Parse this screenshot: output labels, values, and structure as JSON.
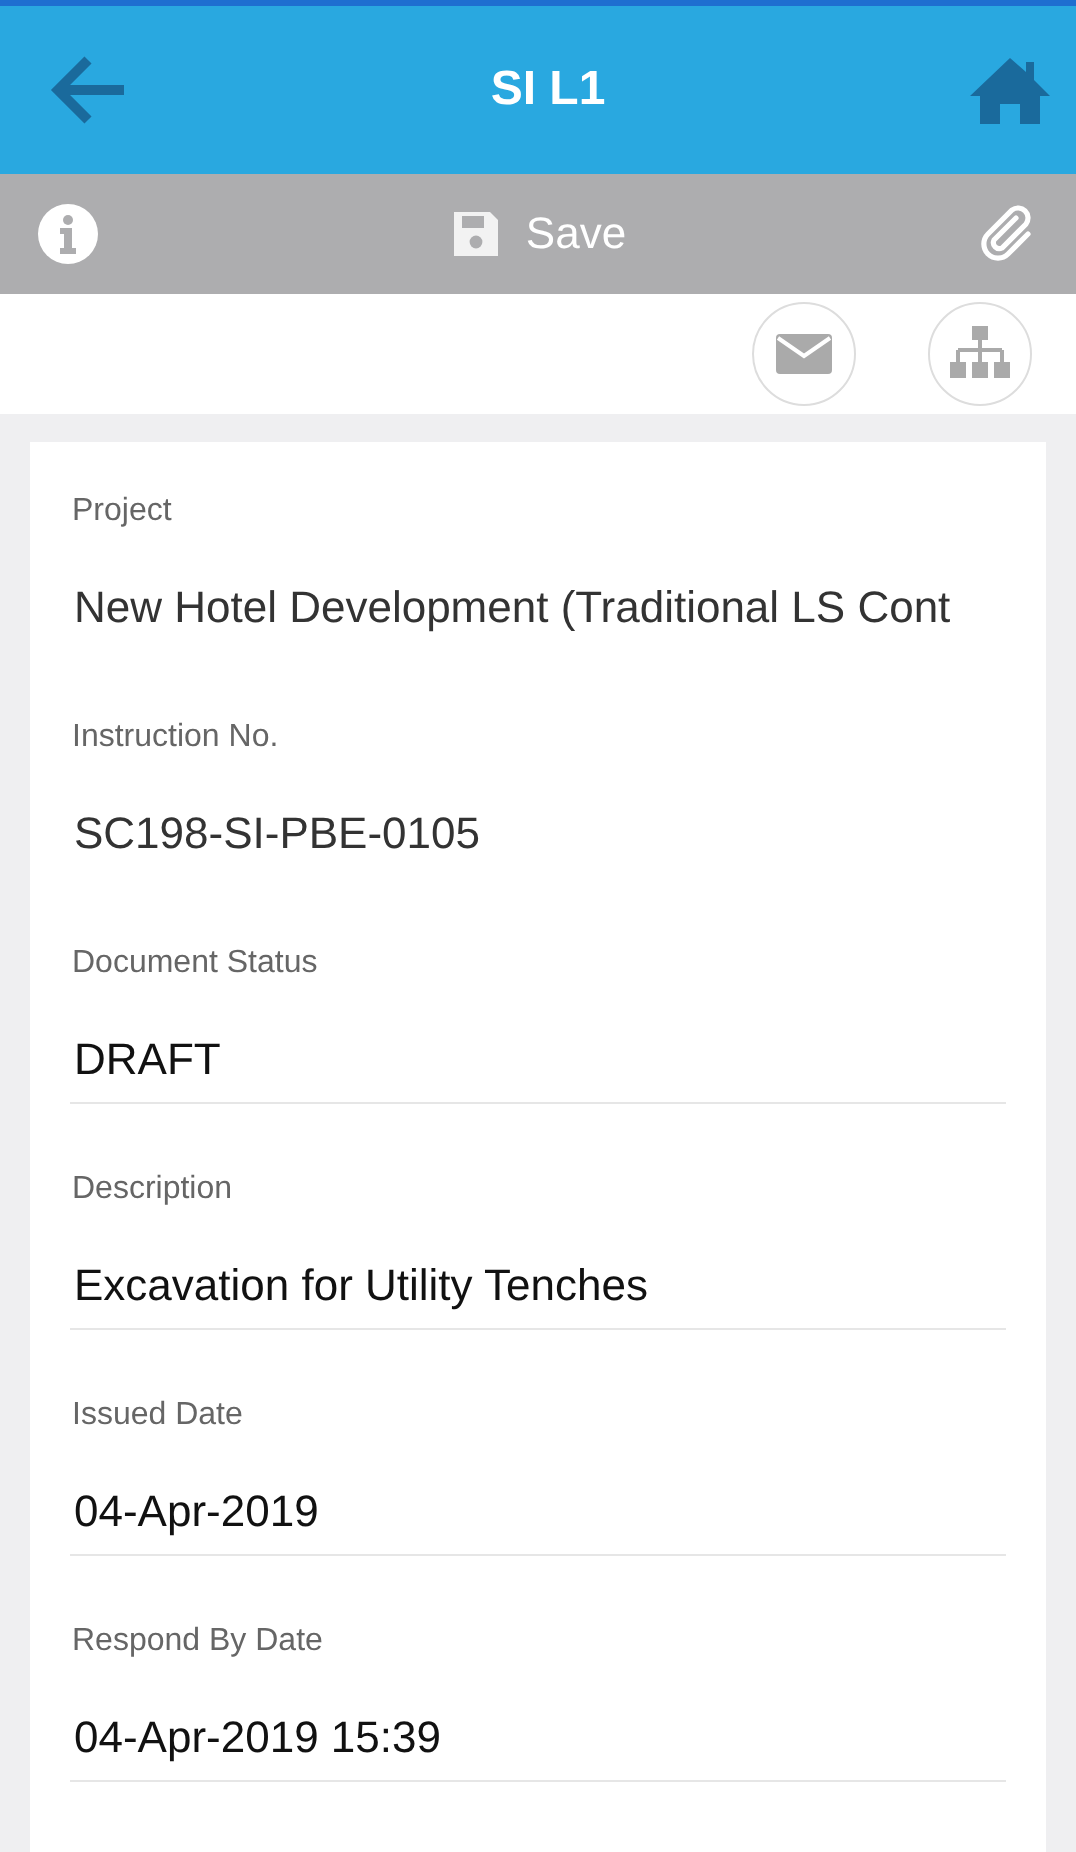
{
  "header": {
    "title": "SI L1"
  },
  "toolbar": {
    "save_label": "Save"
  },
  "fields": [
    {
      "label": "Project",
      "value": "New Hotel Development (Traditional LS Cont",
      "kind": "text"
    },
    {
      "label": "Instruction No.",
      "value": "SC198-SI-PBE-0105",
      "kind": "text"
    },
    {
      "label": "Document Status",
      "value": "DRAFT",
      "kind": "field"
    },
    {
      "label": "Description",
      "value": "Excavation for Utility Tenches",
      "kind": "field"
    },
    {
      "label": "Issued Date",
      "value": "04-Apr-2019",
      "kind": "field"
    },
    {
      "label": "Respond By Date",
      "value": "04-Apr-2019 15:39",
      "kind": "field"
    }
  ]
}
